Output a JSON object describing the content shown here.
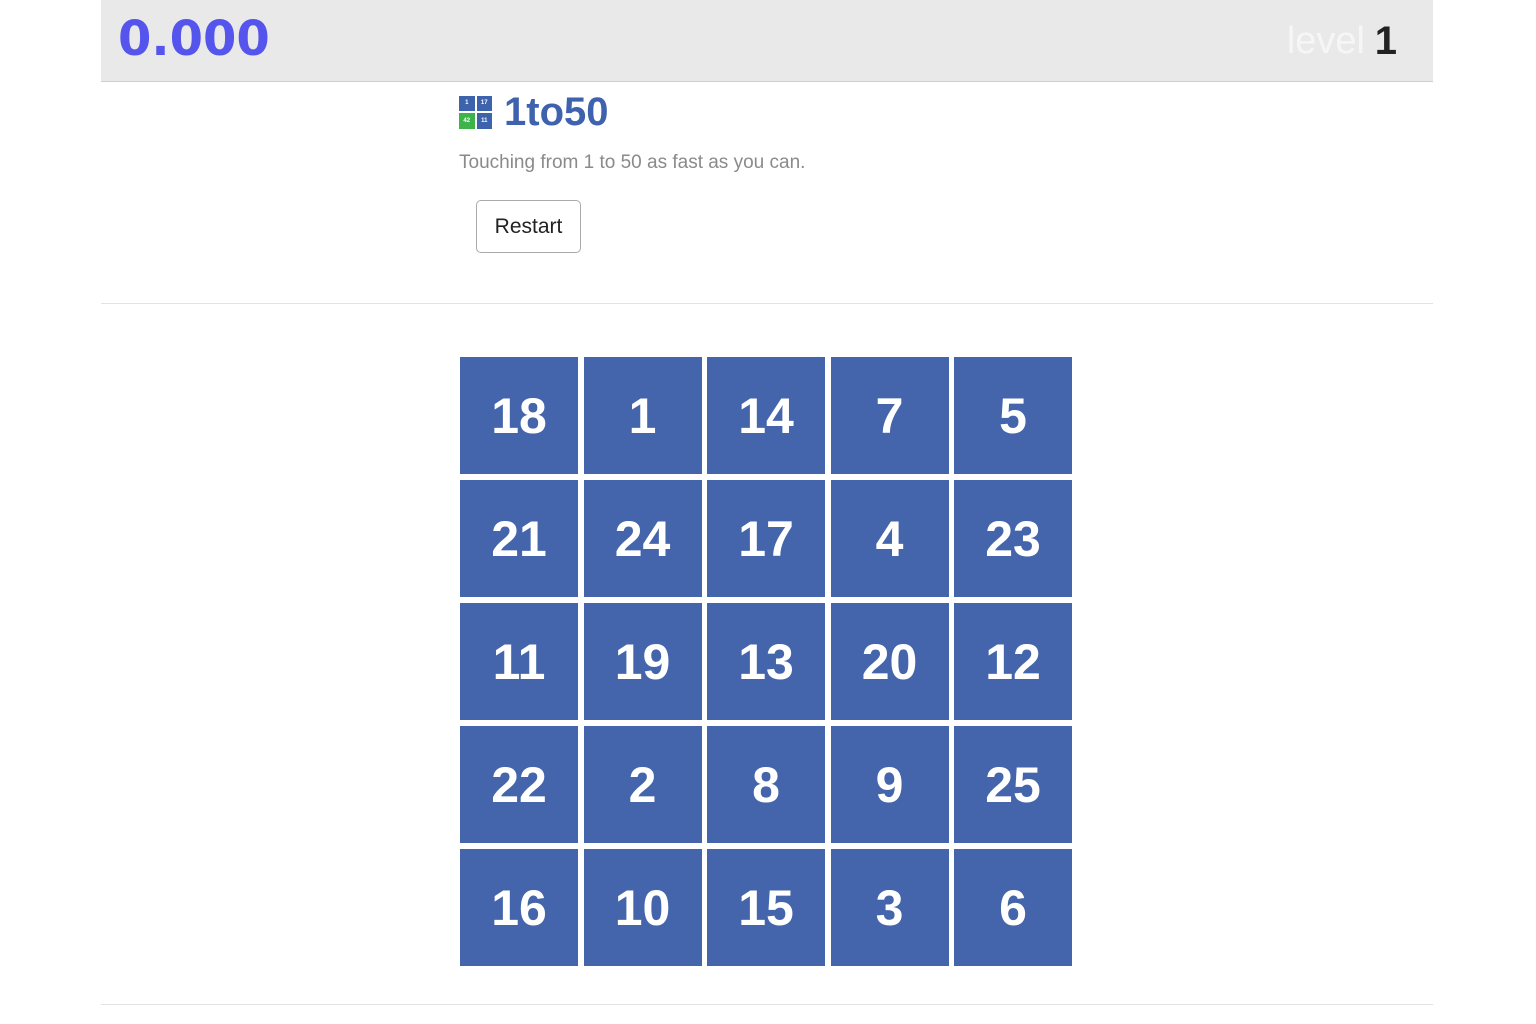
{
  "topbar": {
    "timer": "0.000",
    "level_label": "level",
    "level_value": "1"
  },
  "header": {
    "logo": {
      "icon": "grid-logo-icon",
      "cells": [
        "1",
        "17",
        "42",
        "11"
      ]
    },
    "title": "1to50",
    "subtitle": "Touching from 1 to 50 as fast as you can.",
    "restart_label": "Restart"
  },
  "colors": {
    "timer": "#5555ee",
    "title": "#3f62ae",
    "tile": "#4465ab",
    "tile_text": "#ffffff",
    "topbar_bg": "#e9e9e9"
  },
  "board": {
    "tiles": [
      "18",
      "1",
      "14",
      "7",
      "5",
      "21",
      "24",
      "17",
      "4",
      "23",
      "11",
      "19",
      "13",
      "20",
      "12",
      "22",
      "2",
      "8",
      "9",
      "25",
      "16",
      "10",
      "15",
      "3",
      "6"
    ]
  }
}
